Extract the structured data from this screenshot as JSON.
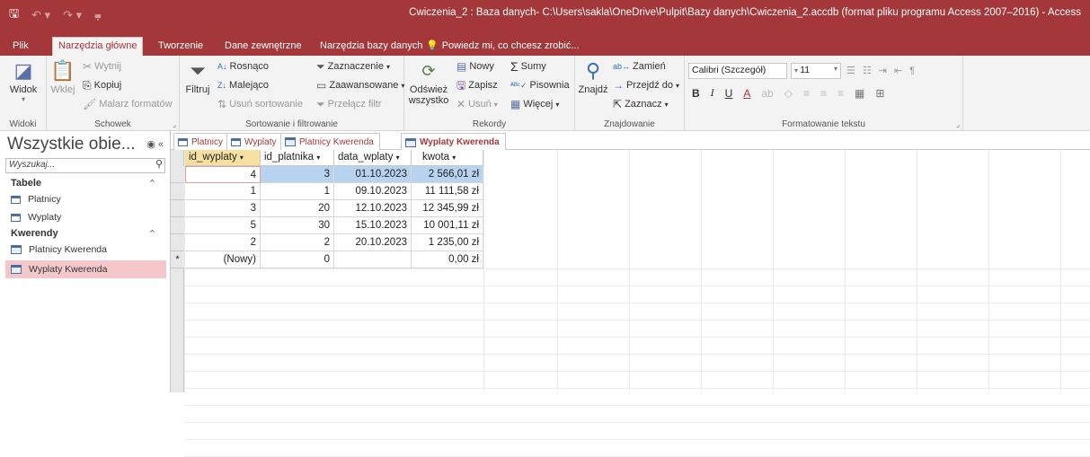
{
  "title": "Cwiczenia_2 : Baza danych- C:\\Users\\sakla\\OneDrive\\Pulpit\\Bazy danych\\Cwiczenia_2.accdb (format pliku programu Access 2007–2016) - Access",
  "colors": {
    "accent": "#a4373a",
    "selected_row": "#b7d3ef",
    "active_header": "#f7e0a0",
    "nav_selected": "#f4c8cb"
  },
  "ribbon_tabs": [
    "Plik",
    "Narzędzia główne",
    "Tworzenie",
    "Dane zewnętrzne",
    "Narzędzia bazy danych"
  ],
  "tell_me": "Powiedz mi, co chcesz zrobić...",
  "ribbon": {
    "widok": "Widok",
    "wklej": "Wklej",
    "wytnij": "Wytnij",
    "kopiuj": "Kopiuj",
    "malarz": "Malarz formatów",
    "filtruj": "Filtruj",
    "rosnaco": "Rosnąco",
    "malejaco": "Malejąco",
    "usun_sort": "Usuń sortowanie",
    "zaznaczenie": "Zaznaczenie",
    "zaawansowane": "Zaawansowane",
    "przelacz": "Przełącz filtr",
    "odswiez1": "Odśwież",
    "odswiez2": "wszystko",
    "nowy": "Nowy",
    "zapisz": "Zapisz",
    "usun": "Usuń",
    "sumy": "Sumy",
    "pisownia": "Pisownia",
    "wiecej": "Więcej",
    "znajdz": "Znajdź",
    "zamien": "Zamień",
    "przejdz": "Przejdź do",
    "zaznacz": "Zaznacz",
    "font": "Calibri (Szczegół)",
    "size": "11",
    "groups": {
      "widoki": "Widoki",
      "schowek": "Schowek",
      "sort": "Sortowanie i filtrowanie",
      "rekordy": "Rekordy",
      "znajdowanie": "Znajdowanie",
      "format": "Formatowanie tekstu"
    }
  },
  "nav": {
    "header": "Wszystkie obie...",
    "search_placeholder": "Wyszukaj...",
    "sections": [
      {
        "label": "Tabele",
        "items": [
          "Platnicy",
          "Wyplaty"
        ]
      },
      {
        "label": "Kwerendy",
        "items": [
          "Platnicy Kwerenda",
          "Wyplaty Kwerenda"
        ]
      }
    ]
  },
  "doc_tabs": [
    "Platnicy",
    "Wyplaty",
    "Platnicy Kwerenda",
    "Wyplaty Kwerenda"
  ],
  "datasheet": {
    "columns": [
      "id_wyplaty",
      "id_platnika",
      "data_wplaty",
      "kwota"
    ],
    "rows": [
      [
        "4",
        "3",
        "01.10.2023",
        "2 566,01 zł"
      ],
      [
        "1",
        "1",
        "09.10.2023",
        "11 111,58 zł"
      ],
      [
        "3",
        "20",
        "12.10.2023",
        "12 345,99 zł"
      ],
      [
        "5",
        "30",
        "15.10.2023",
        "10 001,11 zł"
      ],
      [
        "2",
        "2",
        "20.10.2023",
        "1 235,00 zł"
      ]
    ],
    "new_row": [
      "(Nowy)",
      "0",
      "",
      "0,00 zł"
    ],
    "new_row_marker": "*"
  }
}
